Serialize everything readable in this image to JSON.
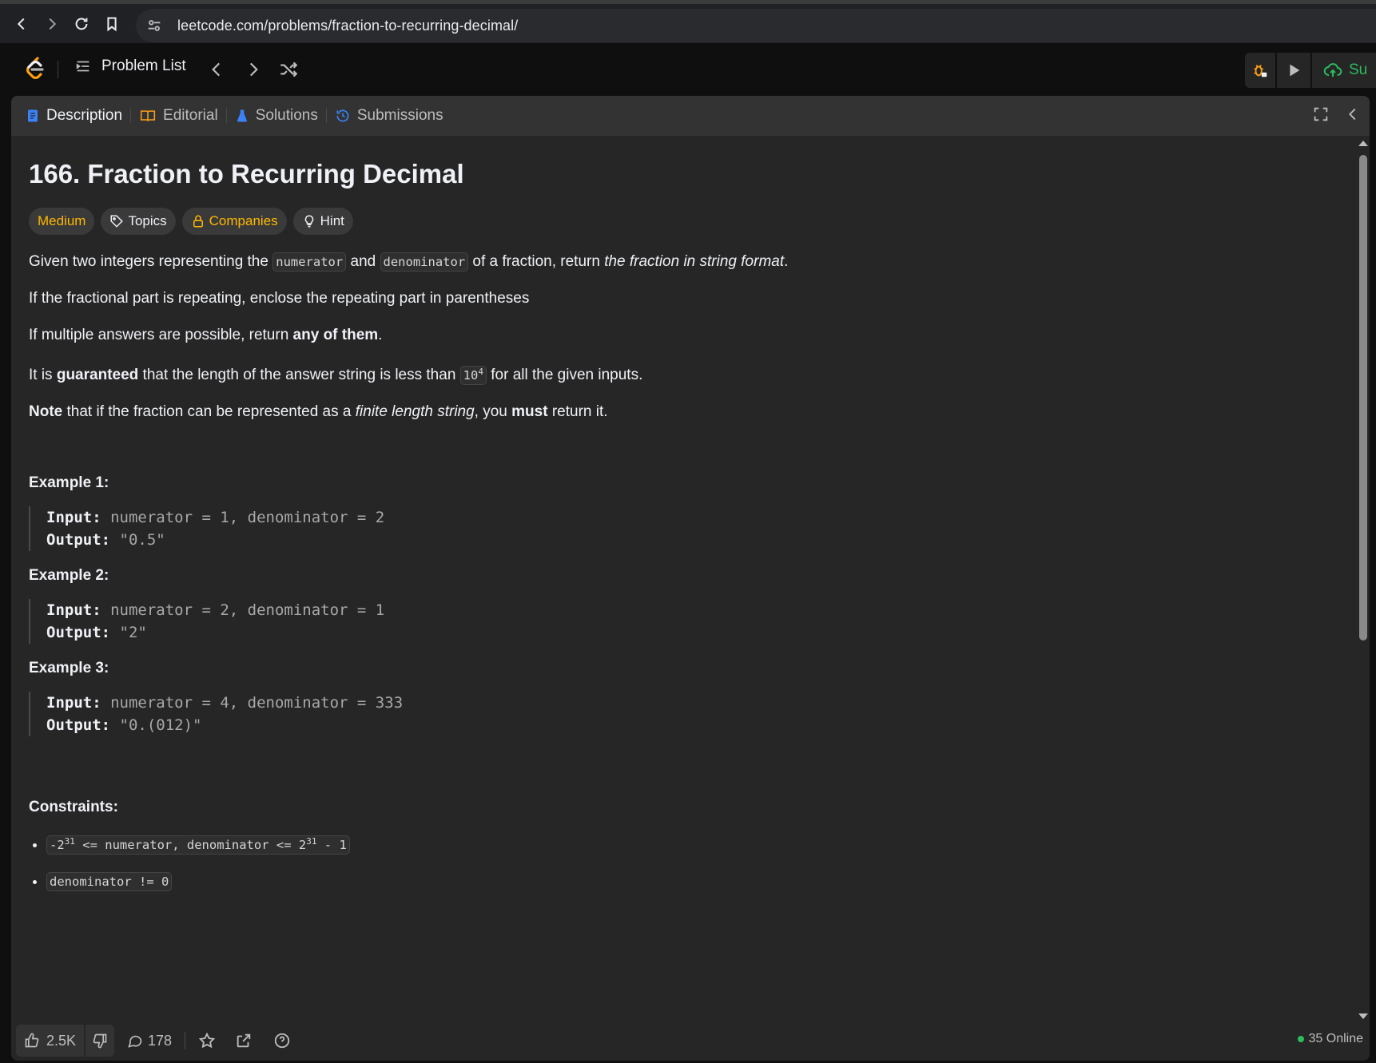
{
  "browser": {
    "url": "leetcode.com/problems/fraction-to-recurring-decimal/"
  },
  "nav": {
    "problem_list": "Problem List",
    "submit_label": "Su"
  },
  "tabs": [
    {
      "label": "Description"
    },
    {
      "label": "Editorial"
    },
    {
      "label": "Solutions"
    },
    {
      "label": "Submissions"
    }
  ],
  "problem": {
    "title": "166. Fraction to Recurring Decimal",
    "tags": {
      "difficulty": "Medium",
      "topics": "Topics",
      "companies": "Companies",
      "hint": "Hint"
    },
    "p1": {
      "t1": "Given two integers representing the ",
      "c1": "numerator",
      "t2": " and ",
      "c2": "denominator",
      "t3": " of a fraction, return ",
      "em": "the fraction in string format",
      "t4": "."
    },
    "p2": "If the fractional part is repeating, enclose the repeating part in parentheses",
    "p3": {
      "t1": "If multiple answers are possible, return ",
      "b": "any of them",
      "t2": "."
    },
    "p4": {
      "t1": "It is ",
      "b": "guaranteed",
      "t2": " that the length of the answer string is less than ",
      "code_base": "10",
      "code_exp": "4",
      "t3": " for all the given inputs."
    },
    "p5": {
      "b1": "Note",
      "t1": " that if the fraction can be represented as a ",
      "em": "finite length string",
      "t2": ", you ",
      "b2": "must",
      "t3": " return it."
    },
    "examples": [
      {
        "title": "Example 1:",
        "input_label": "Input:",
        "input": " numerator = 1, denominator = 2",
        "output_label": "Output:",
        "output": " \"0.5\""
      },
      {
        "title": "Example 2:",
        "input_label": "Input:",
        "input": " numerator = 2, denominator = 1",
        "output_label": "Output:",
        "output": " \"2\""
      },
      {
        "title": "Example 3:",
        "input_label": "Input:",
        "input": " numerator = 4, denominator = 333",
        "output_label": "Output:",
        "output": " \"0.(012)\""
      }
    ],
    "constraints_title": "Constraints:",
    "constraints": {
      "c1": {
        "a": "-2",
        "a_exp": "31",
        "b": " <= numerator, denominator <= 2",
        "b_exp": "31",
        "c": " - 1"
      },
      "c2": "denominator != 0"
    }
  },
  "footer": {
    "likes": "2.5K",
    "comments": "178",
    "online": "35 Online"
  },
  "colors": {
    "medium": "#ffb800",
    "online_dot": "#2cbb5d",
    "accent_blue": "#3b82f6"
  }
}
